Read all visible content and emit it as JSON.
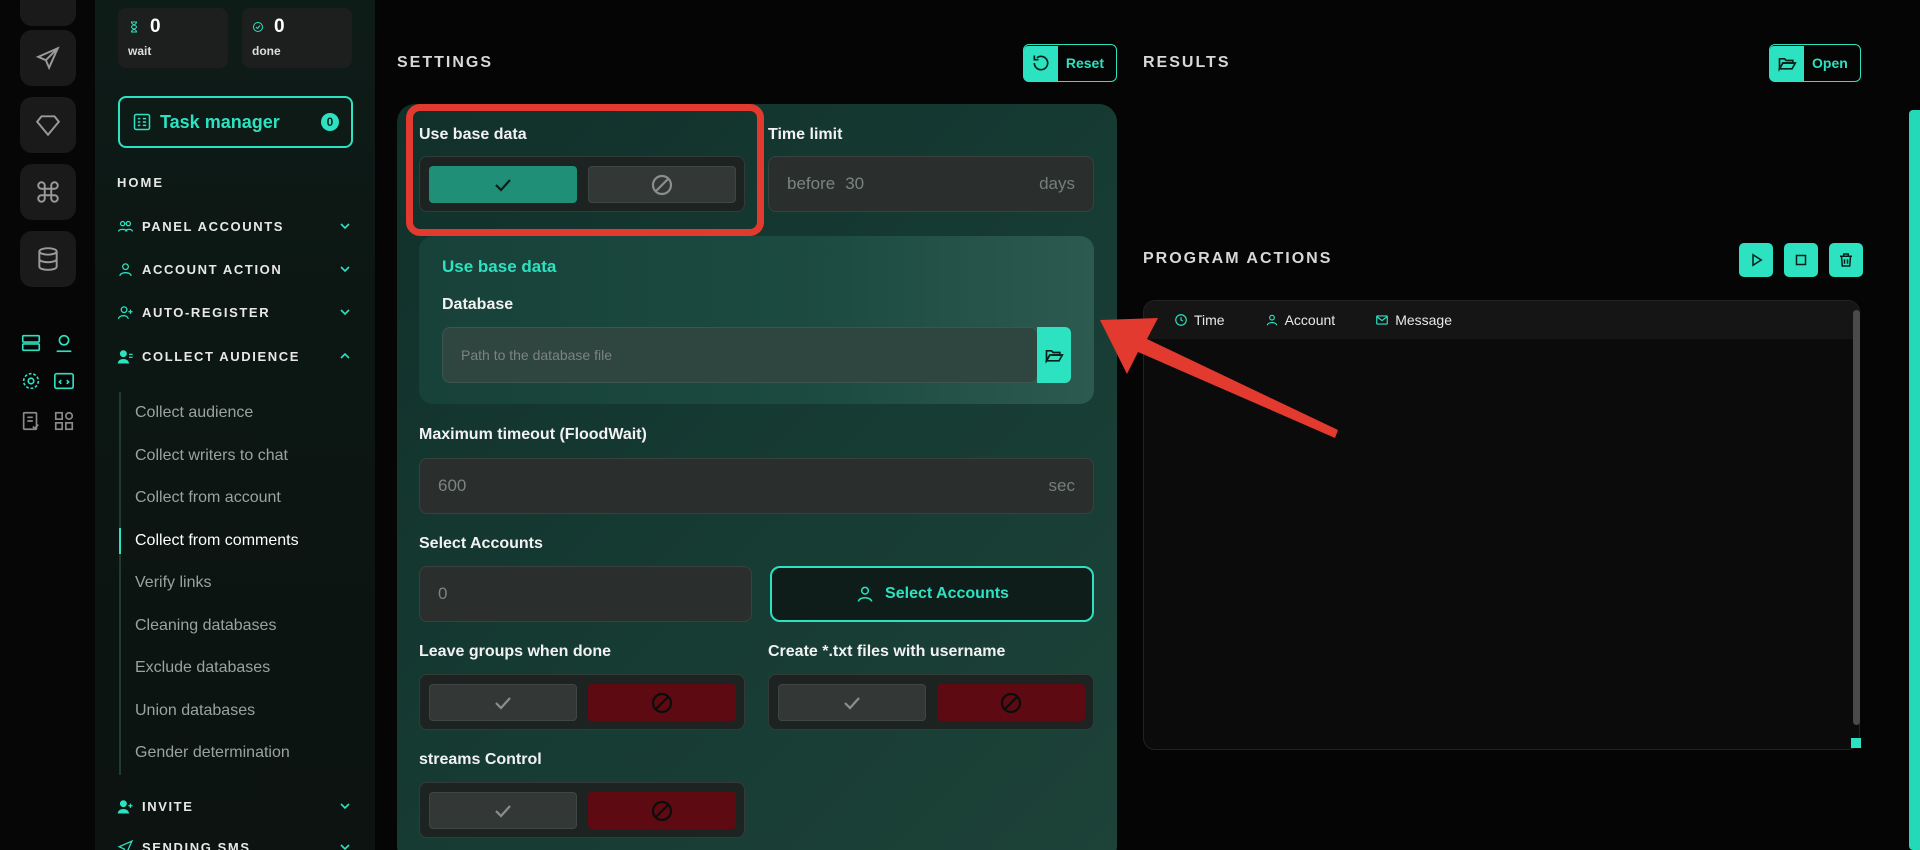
{
  "sidebar": {
    "counters": {
      "wait": {
        "value": "0",
        "label": "wait"
      },
      "done": {
        "value": "0",
        "label": "done"
      }
    },
    "task_manager": {
      "label": "Task manager",
      "badge": "0"
    },
    "home": "HOME",
    "sections": [
      {
        "label": "PANEL ACCOUNTS",
        "icon": "users-icon",
        "expanded": false
      },
      {
        "label": "ACCOUNT ACTION",
        "icon": "user-icon",
        "expanded": false
      },
      {
        "label": "AUTO-REGISTER",
        "icon": "user-plus-icon",
        "expanded": false
      },
      {
        "label": "COLLECT AUDIENCE",
        "icon": "user-group-icon",
        "expanded": true
      },
      {
        "label": "INVITE",
        "icon": "user-add-icon",
        "expanded": false
      },
      {
        "label": "SENDING SMS",
        "icon": "send-icon",
        "expanded": false
      }
    ],
    "collect_items": [
      "Collect audience",
      "Collect writers to chat",
      "Collect from account",
      "Collect from comments",
      "Verify links",
      "Cleaning databases",
      "Exclude databases",
      "Union databases",
      "Gender determination"
    ],
    "active_item": "Collect from comments"
  },
  "settings": {
    "title": "SETTINGS",
    "reset_label": "Reset",
    "use_base_data_label": "Use base data",
    "time_limit": {
      "label": "Time limit",
      "prefix": "before",
      "value": "30",
      "suffix": "days"
    },
    "base_data_panel": {
      "title": "Use base data",
      "database_label": "Database",
      "database_placeholder": "Path to the database file"
    },
    "max_timeout": {
      "label": "Maximum timeout (FloodWait)",
      "value": "600",
      "suffix": "sec"
    },
    "select_accounts": {
      "label": "Select Accounts",
      "value": "0",
      "button_label": "Select Accounts"
    },
    "leave_groups_label": "Leave groups when done",
    "create_txt_label": "Create *.txt files with username",
    "streams_control_label": "streams Control"
  },
  "results": {
    "title": "RESULTS",
    "open_label": "Open"
  },
  "program_actions": {
    "title": "PROGRAM ACTIONS",
    "columns": [
      "Time",
      "Account",
      "Message"
    ]
  },
  "colors": {
    "accent": "#2de2c0",
    "annotation": "#e23a2e",
    "toggle_off": "#5e0a12"
  }
}
